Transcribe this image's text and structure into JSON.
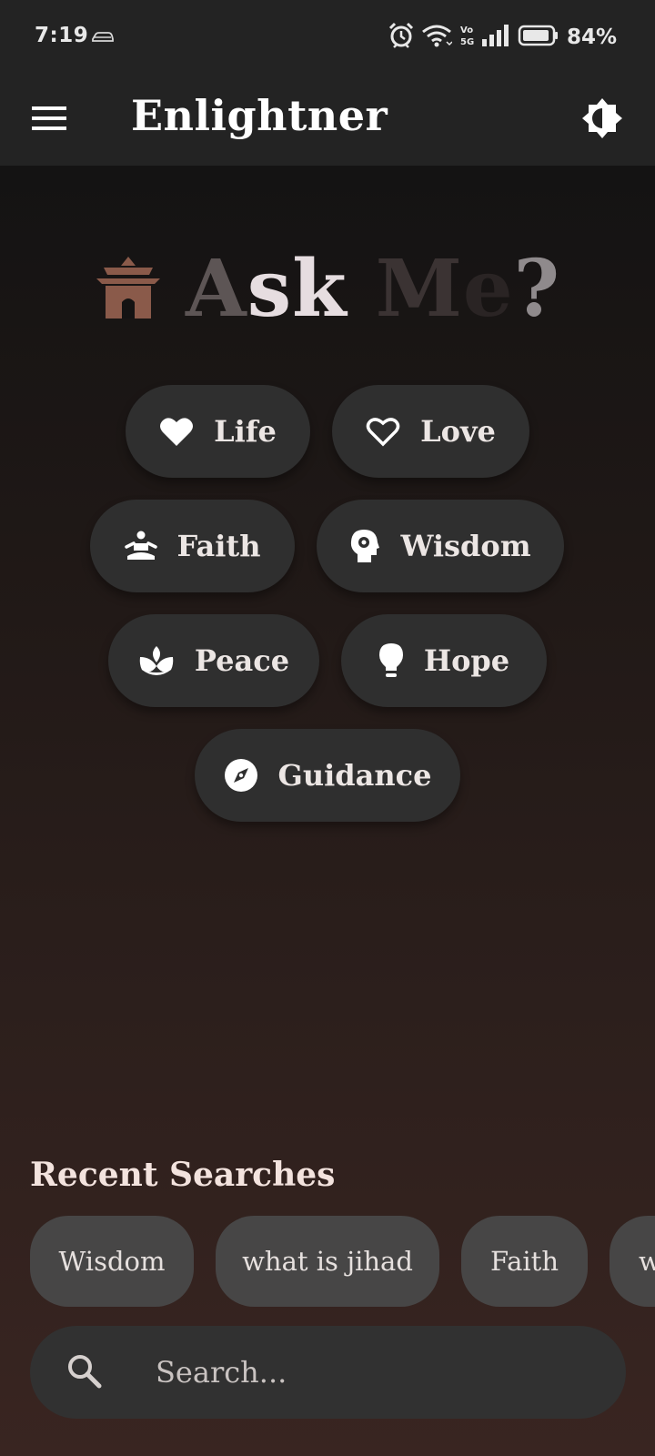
{
  "status_bar": {
    "time": "7:19",
    "battery": "84%",
    "icons": [
      "car-icon",
      "alarm-icon",
      "wifi-icon",
      "volte-icon",
      "signal-icon",
      "battery-icon"
    ]
  },
  "app_bar": {
    "title": "Enlightner",
    "menu_icon": "hamburger-menu-icon",
    "theme_icon": "brightness-contrast-icon"
  },
  "hero": {
    "title_parts": [
      "A",
      "sk",
      "M",
      "e",
      "?"
    ],
    "icon": "temple-icon",
    "icon_color": "#8a5a4a"
  },
  "topics": [
    {
      "label": "Life",
      "icon": "heart-filled-icon"
    },
    {
      "label": "Love",
      "icon": "heart-outline-icon"
    },
    {
      "label": "Faith",
      "icon": "meditation-icon"
    },
    {
      "label": "Wisdom",
      "icon": "head-gear-icon"
    },
    {
      "label": "Peace",
      "icon": "lotus-icon"
    },
    {
      "label": "Hope",
      "icon": "lightbulb-icon"
    },
    {
      "label": "Guidance",
      "icon": "compass-icon"
    }
  ],
  "recent": {
    "title": "Recent Searches",
    "items": [
      "Wisdom",
      "what is jihad",
      "Faith",
      "w"
    ]
  },
  "search": {
    "placeholder": "Search...",
    "icon": "search-icon"
  },
  "colors": {
    "chip_bg": "#2f2f2f",
    "recent_chip_bg": "#474646",
    "bar_bg": "#232323"
  }
}
